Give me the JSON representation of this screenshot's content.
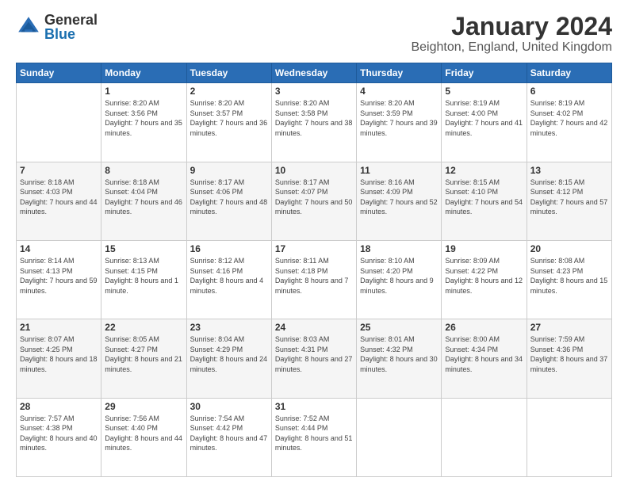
{
  "logo": {
    "general": "General",
    "blue": "Blue"
  },
  "header": {
    "title": "January 2024",
    "subtitle": "Beighton, England, United Kingdom"
  },
  "weekdays": [
    "Sunday",
    "Monday",
    "Tuesday",
    "Wednesday",
    "Thursday",
    "Friday",
    "Saturday"
  ],
  "weeks": [
    [
      {
        "day": "",
        "sunrise": "",
        "sunset": "",
        "daylight": ""
      },
      {
        "day": "1",
        "sunrise": "Sunrise: 8:20 AM",
        "sunset": "Sunset: 3:56 PM",
        "daylight": "Daylight: 7 hours and 35 minutes."
      },
      {
        "day": "2",
        "sunrise": "Sunrise: 8:20 AM",
        "sunset": "Sunset: 3:57 PM",
        "daylight": "Daylight: 7 hours and 36 minutes."
      },
      {
        "day": "3",
        "sunrise": "Sunrise: 8:20 AM",
        "sunset": "Sunset: 3:58 PM",
        "daylight": "Daylight: 7 hours and 38 minutes."
      },
      {
        "day": "4",
        "sunrise": "Sunrise: 8:20 AM",
        "sunset": "Sunset: 3:59 PM",
        "daylight": "Daylight: 7 hours and 39 minutes."
      },
      {
        "day": "5",
        "sunrise": "Sunrise: 8:19 AM",
        "sunset": "Sunset: 4:00 PM",
        "daylight": "Daylight: 7 hours and 41 minutes."
      },
      {
        "day": "6",
        "sunrise": "Sunrise: 8:19 AM",
        "sunset": "Sunset: 4:02 PM",
        "daylight": "Daylight: 7 hours and 42 minutes."
      }
    ],
    [
      {
        "day": "7",
        "sunrise": "Sunrise: 8:18 AM",
        "sunset": "Sunset: 4:03 PM",
        "daylight": "Daylight: 7 hours and 44 minutes."
      },
      {
        "day": "8",
        "sunrise": "Sunrise: 8:18 AM",
        "sunset": "Sunset: 4:04 PM",
        "daylight": "Daylight: 7 hours and 46 minutes."
      },
      {
        "day": "9",
        "sunrise": "Sunrise: 8:17 AM",
        "sunset": "Sunset: 4:06 PM",
        "daylight": "Daylight: 7 hours and 48 minutes."
      },
      {
        "day": "10",
        "sunrise": "Sunrise: 8:17 AM",
        "sunset": "Sunset: 4:07 PM",
        "daylight": "Daylight: 7 hours and 50 minutes."
      },
      {
        "day": "11",
        "sunrise": "Sunrise: 8:16 AM",
        "sunset": "Sunset: 4:09 PM",
        "daylight": "Daylight: 7 hours and 52 minutes."
      },
      {
        "day": "12",
        "sunrise": "Sunrise: 8:15 AM",
        "sunset": "Sunset: 4:10 PM",
        "daylight": "Daylight: 7 hours and 54 minutes."
      },
      {
        "day": "13",
        "sunrise": "Sunrise: 8:15 AM",
        "sunset": "Sunset: 4:12 PM",
        "daylight": "Daylight: 7 hours and 57 minutes."
      }
    ],
    [
      {
        "day": "14",
        "sunrise": "Sunrise: 8:14 AM",
        "sunset": "Sunset: 4:13 PM",
        "daylight": "Daylight: 7 hours and 59 minutes."
      },
      {
        "day": "15",
        "sunrise": "Sunrise: 8:13 AM",
        "sunset": "Sunset: 4:15 PM",
        "daylight": "Daylight: 8 hours and 1 minute."
      },
      {
        "day": "16",
        "sunrise": "Sunrise: 8:12 AM",
        "sunset": "Sunset: 4:16 PM",
        "daylight": "Daylight: 8 hours and 4 minutes."
      },
      {
        "day": "17",
        "sunrise": "Sunrise: 8:11 AM",
        "sunset": "Sunset: 4:18 PM",
        "daylight": "Daylight: 8 hours and 7 minutes."
      },
      {
        "day": "18",
        "sunrise": "Sunrise: 8:10 AM",
        "sunset": "Sunset: 4:20 PM",
        "daylight": "Daylight: 8 hours and 9 minutes."
      },
      {
        "day": "19",
        "sunrise": "Sunrise: 8:09 AM",
        "sunset": "Sunset: 4:22 PM",
        "daylight": "Daylight: 8 hours and 12 minutes."
      },
      {
        "day": "20",
        "sunrise": "Sunrise: 8:08 AM",
        "sunset": "Sunset: 4:23 PM",
        "daylight": "Daylight: 8 hours and 15 minutes."
      }
    ],
    [
      {
        "day": "21",
        "sunrise": "Sunrise: 8:07 AM",
        "sunset": "Sunset: 4:25 PM",
        "daylight": "Daylight: 8 hours and 18 minutes."
      },
      {
        "day": "22",
        "sunrise": "Sunrise: 8:05 AM",
        "sunset": "Sunset: 4:27 PM",
        "daylight": "Daylight: 8 hours and 21 minutes."
      },
      {
        "day": "23",
        "sunrise": "Sunrise: 8:04 AM",
        "sunset": "Sunset: 4:29 PM",
        "daylight": "Daylight: 8 hours and 24 minutes."
      },
      {
        "day": "24",
        "sunrise": "Sunrise: 8:03 AM",
        "sunset": "Sunset: 4:31 PM",
        "daylight": "Daylight: 8 hours and 27 minutes."
      },
      {
        "day": "25",
        "sunrise": "Sunrise: 8:01 AM",
        "sunset": "Sunset: 4:32 PM",
        "daylight": "Daylight: 8 hours and 30 minutes."
      },
      {
        "day": "26",
        "sunrise": "Sunrise: 8:00 AM",
        "sunset": "Sunset: 4:34 PM",
        "daylight": "Daylight: 8 hours and 34 minutes."
      },
      {
        "day": "27",
        "sunrise": "Sunrise: 7:59 AM",
        "sunset": "Sunset: 4:36 PM",
        "daylight": "Daylight: 8 hours and 37 minutes."
      }
    ],
    [
      {
        "day": "28",
        "sunrise": "Sunrise: 7:57 AM",
        "sunset": "Sunset: 4:38 PM",
        "daylight": "Daylight: 8 hours and 40 minutes."
      },
      {
        "day": "29",
        "sunrise": "Sunrise: 7:56 AM",
        "sunset": "Sunset: 4:40 PM",
        "daylight": "Daylight: 8 hours and 44 minutes."
      },
      {
        "day": "30",
        "sunrise": "Sunrise: 7:54 AM",
        "sunset": "Sunset: 4:42 PM",
        "daylight": "Daylight: 8 hours and 47 minutes."
      },
      {
        "day": "31",
        "sunrise": "Sunrise: 7:52 AM",
        "sunset": "Sunset: 4:44 PM",
        "daylight": "Daylight: 8 hours and 51 minutes."
      },
      {
        "day": "",
        "sunrise": "",
        "sunset": "",
        "daylight": ""
      },
      {
        "day": "",
        "sunrise": "",
        "sunset": "",
        "daylight": ""
      },
      {
        "day": "",
        "sunrise": "",
        "sunset": "",
        "daylight": ""
      }
    ]
  ]
}
